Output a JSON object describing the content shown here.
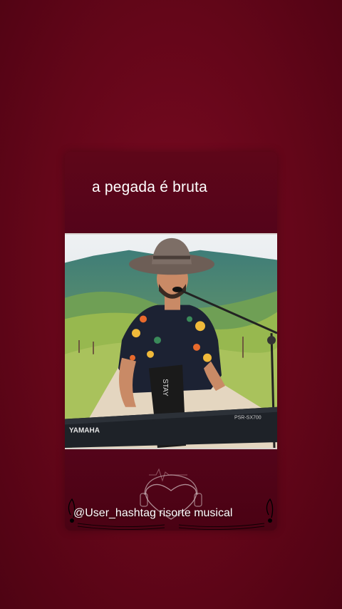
{
  "post": {
    "caption": "a pegada é bruta",
    "watermark": "@User_hashtag risorte musical"
  },
  "video": {
    "keyboard_brand": "YAMAHA",
    "keyboard_model": "PSR-SX700",
    "stand_text": "STAY"
  },
  "colors": {
    "background": "#640619",
    "card": "#54041a",
    "text": "#ffffff"
  },
  "icons": [
    "music-note-icon",
    "heart-headphones-icon",
    "heartbeat-icon"
  ]
}
